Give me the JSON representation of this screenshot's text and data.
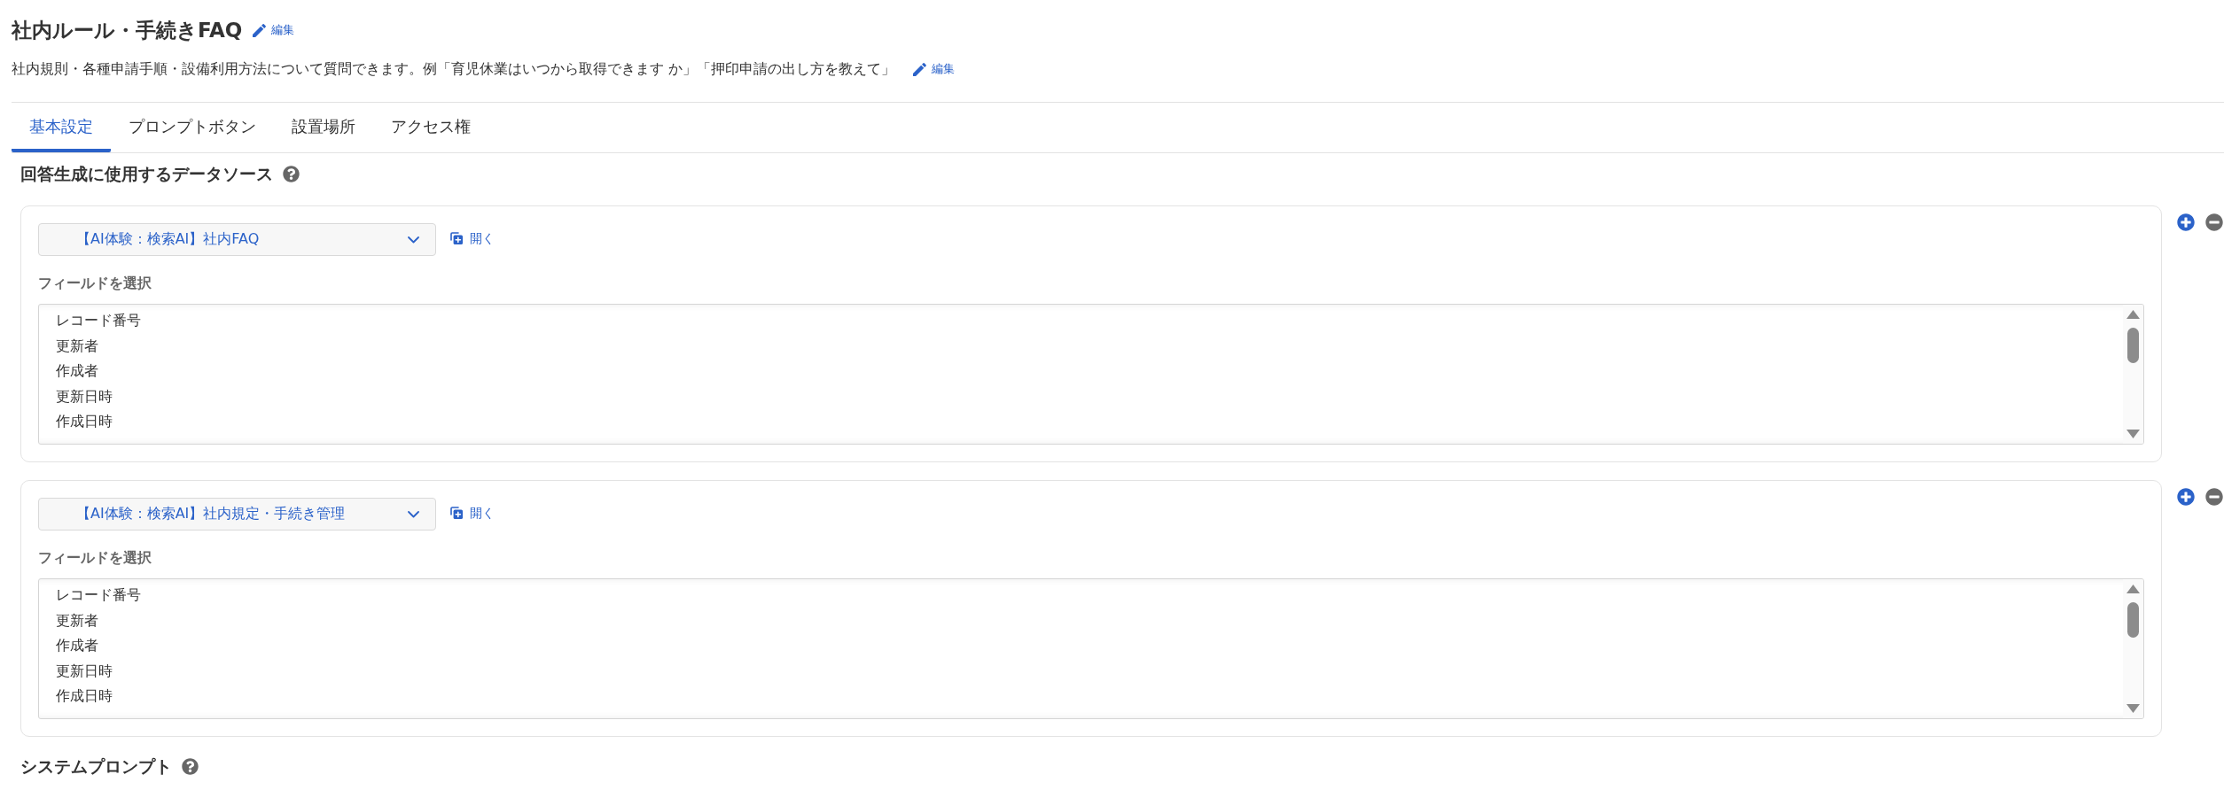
{
  "header": {
    "title": "社内ルール・手続きFAQ",
    "title_edit": "編集",
    "description": "社内規則・各種申請手順・設備利用方法について質問できます。例「育児休業はいつから取得できます か」「押印申請の出し方を教えて」",
    "description_edit": "編集"
  },
  "tabs": [
    {
      "label": "基本設定",
      "selected": true
    },
    {
      "label": "プロンプトボタン",
      "selected": false
    },
    {
      "label": "設置場所",
      "selected": false
    },
    {
      "label": "アクセス権",
      "selected": false
    }
  ],
  "data_sources": {
    "heading": "回答生成に使用するデータソース",
    "items": [
      {
        "source": "【AI体験：検索AI】社内FAQ",
        "open_link": "開く",
        "field_label": "フィールドを選択",
        "fields": [
          "レコード番号",
          "更新者",
          "作成者",
          "更新日時",
          "作成日時"
        ]
      },
      {
        "source": "【AI体験：検索AI】社内規定・手続き管理",
        "open_link": "開く",
        "field_label": "フィールドを選択",
        "fields": [
          "レコード番号",
          "更新者",
          "作成者",
          "更新日時",
          "作成日時"
        ]
      }
    ]
  },
  "system_prompt": {
    "heading": "システムプロンプト"
  }
}
